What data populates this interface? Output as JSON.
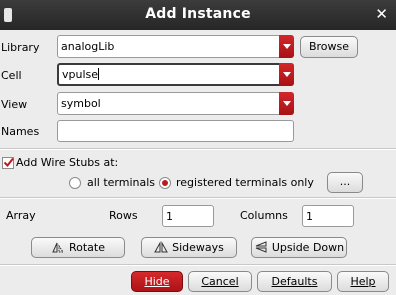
{
  "window": {
    "title": "Add Instance"
  },
  "form": {
    "library_label": "Library",
    "library_value": "analogLib",
    "browse_label": "Browse",
    "cell_label": "Cell",
    "cell_value": "vpulse",
    "view_label": "View",
    "view_value": "symbol",
    "names_label": "Names",
    "names_value": ""
  },
  "wire_stubs": {
    "label": "Add Wire Stubs at:",
    "checked": true,
    "option_all": "all terminals",
    "option_registered": "registered terminals only",
    "selected": "registered terminals only",
    "more_label": "..."
  },
  "array": {
    "label": "Array",
    "rows_label": "Rows",
    "rows_value": "1",
    "columns_label": "Columns",
    "columns_value": "1"
  },
  "transform": {
    "rotate": "Rotate",
    "sideways": "Sideways",
    "upside_down": "Upside Down"
  },
  "footer": {
    "hide": "Hide",
    "cancel": "Cancel",
    "defaults": "Defaults",
    "help": "Help"
  },
  "colors": {
    "accent": "#c0191d",
    "titlebar": "#2e2e2e",
    "background": "#ececec"
  }
}
